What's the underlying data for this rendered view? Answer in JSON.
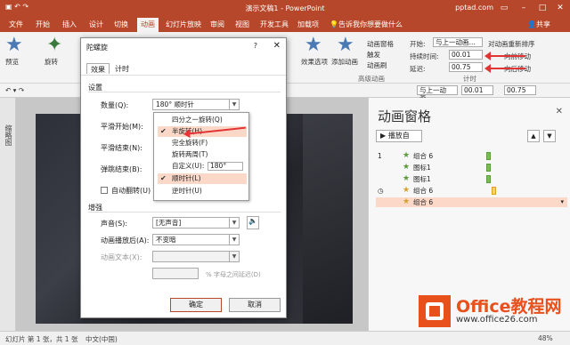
{
  "titlebar": {
    "title": "演示文稿1 - PowerPoint",
    "account": "pptad.com"
  },
  "menu": {
    "tabs": [
      "文件",
      "开始",
      "插入",
      "设计",
      "切换",
      "动画",
      "幻灯片放映",
      "审阅",
      "视图",
      "开发工具",
      "加载项"
    ],
    "active": "动画",
    "tell_me": "告诉我你想要做什么",
    "share": "共享"
  },
  "ribbon": {
    "preview": "预览",
    "rotate": "旋转",
    "effect_options": "效果选项",
    "add_animation": "添加动画",
    "animation_pane": "动画窗格",
    "trigger": "触发",
    "animation_painter": "动画刷",
    "advanced_group": "高级动画",
    "start_label": "开始:",
    "start_value": "与上一动画…",
    "duration_label": "持续时间:",
    "duration_value": "00.01",
    "delay_label": "延迟:",
    "delay_value": "00.75",
    "reorder": "对动画重新排序",
    "move_earlier": "向前移动",
    "move_later": "向后移动",
    "timing_group": "计时"
  },
  "toolbar2": {
    "start_value": "与上一动画…",
    "duration": "00.01",
    "delay": "00.75"
  },
  "leftpane": {
    "label": "缩略图"
  },
  "dialog": {
    "title": "陀螺旋",
    "help": "?",
    "close": "✕",
    "tabs": [
      "效果",
      "计时"
    ],
    "section_settings": "设置",
    "amount_label": "数量(Q):",
    "amount_value": "180° 顺时针",
    "smooth_start_label": "平滑开始(M):",
    "smooth_end_label": "平滑结束(N):",
    "bounce_end_label": "弹跳结束(B):",
    "auto_reverse_label": "自动翻转(U)",
    "section_enhance": "增强",
    "sound_label": "声音(S):",
    "sound_value": "[无声音]",
    "after_label": "动画播放后(A):",
    "after_value": "不变暗",
    "text_label": "动画文本(X):",
    "percent_note": "% 字母之间延迟(D)",
    "ok": "确定",
    "cancel": "取消",
    "dropdown": {
      "items": [
        "四分之一旋转(Q)",
        "半旋转(H)",
        "完全旋转(F)",
        "旋转两周(T)",
        "自定义(U):",
        "顺时针(L)",
        "逆时针(U)"
      ],
      "custom_value": "180°",
      "checked": [
        "半旋转(H)",
        "顺时针(L)"
      ]
    }
  },
  "pane": {
    "title": "动画窗格",
    "close": "✕",
    "play_label": "播放自",
    "rows": [
      {
        "num": "1",
        "name": "组合 6"
      },
      {
        "num": "",
        "name": "图标1"
      },
      {
        "num": "",
        "name": "图标1"
      },
      {
        "num": "",
        "name": "组合 6"
      },
      {
        "num": "",
        "name": "组合 6"
      },
      {
        "num": "",
        "name": "组合 6"
      }
    ]
  },
  "statusbar": {
    "slide": "幻灯片 第 1 张，共 1 张",
    "lang": "中文(中国)",
    "zoom": "48%"
  },
  "logo": {
    "text": "Office教程网",
    "url": "www.office26.com"
  },
  "colors": {
    "accent": "#b7472a",
    "arrow": "#e23434",
    "selection": "#fbd8c8",
    "logo": "#e8501c"
  }
}
